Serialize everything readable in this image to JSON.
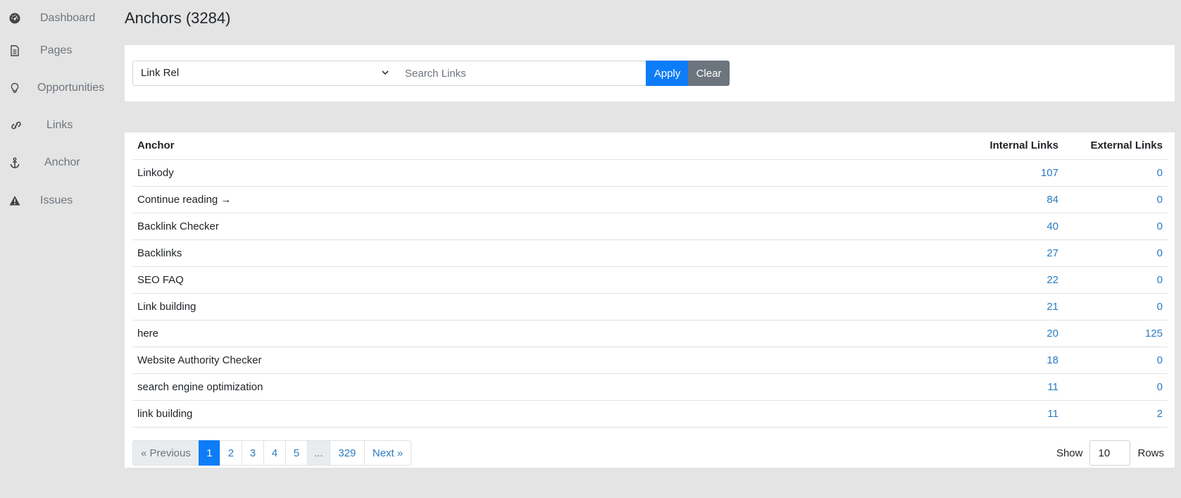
{
  "sidebar": {
    "items": [
      {
        "label": "Dashboard",
        "icon": "dashboard-icon"
      },
      {
        "label": "Pages",
        "icon": "file-icon"
      },
      {
        "label": "Opportunities",
        "icon": "lightbulb-icon"
      },
      {
        "label": "Links",
        "icon": "link-icon"
      },
      {
        "label": "Anchor",
        "icon": "anchor-icon"
      },
      {
        "label": "Issues",
        "icon": "warning-icon"
      }
    ]
  },
  "page": {
    "title": "Anchors (3284)"
  },
  "filter": {
    "select_value": "Link Rel",
    "search_placeholder": "Search Links",
    "apply_label": "Apply",
    "clear_label": "Clear"
  },
  "table": {
    "headers": {
      "anchor": "Anchor",
      "internal": "Internal Links",
      "external": "External Links"
    },
    "rows": [
      {
        "anchor": "Linkody",
        "internal": "107",
        "external": "0"
      },
      {
        "anchor": "Continue reading →",
        "internal": "84",
        "external": "0"
      },
      {
        "anchor": "Backlink Checker",
        "internal": "40",
        "external": "0"
      },
      {
        "anchor": "Backlinks",
        "internal": "27",
        "external": "0"
      },
      {
        "anchor": "SEO FAQ",
        "internal": "22",
        "external": "0"
      },
      {
        "anchor": "Link building",
        "internal": "21",
        "external": "0"
      },
      {
        "anchor": "here",
        "internal": "20",
        "external": "125"
      },
      {
        "anchor": "Website Authority Checker",
        "internal": "18",
        "external": "0"
      },
      {
        "anchor": "search engine optimization",
        "internal": "11",
        "external": "0"
      },
      {
        "anchor": "link building",
        "internal": "11",
        "external": "2"
      }
    ]
  },
  "pagination": {
    "previous": "« Previous",
    "pages": [
      "1",
      "2",
      "3",
      "4",
      "5",
      "...",
      "329"
    ],
    "active": "1",
    "next": "Next »"
  },
  "rows_control": {
    "show_label": "Show",
    "value": "10",
    "rows_label": "Rows"
  },
  "colors": {
    "primary": "#0d7cf7",
    "secondary": "#6c757d",
    "link": "#2a7bc2",
    "background": "#e4e4e4"
  }
}
